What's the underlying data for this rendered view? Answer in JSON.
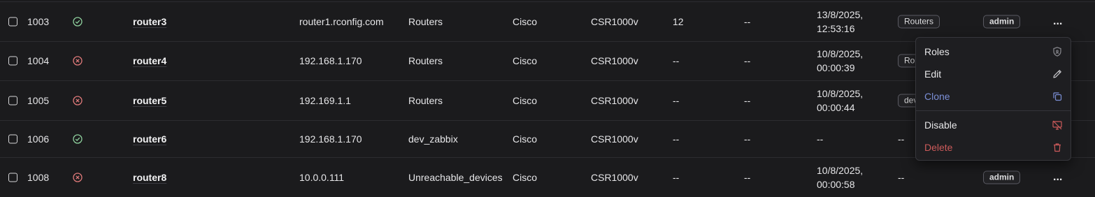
{
  "colors": {
    "background": "#1b1b1d",
    "status_ok": "#8fd19e",
    "status_error": "#e07a7a",
    "clone_text": "#7b8fd6",
    "delete_text": "#cc5a5a"
  },
  "rows": [
    {
      "id": "1003",
      "status": "check-circle-icon",
      "name": "router3",
      "address": "router1.rconfig.com",
      "category": "Routers",
      "vendor": "Cisco",
      "model": "CSR1000v",
      "col8": "12",
      "col9": "--",
      "date_line1": "13/8/2025,",
      "date_line2": "12:53:16",
      "tag": "Routers",
      "user": "admin",
      "more": "..."
    },
    {
      "id": "1004",
      "status": "x-circle-icon",
      "name": "router4",
      "address": "192.168.1.170",
      "category": "Routers",
      "vendor": "Cisco",
      "model": "CSR1000v",
      "col8": "--",
      "col9": "--",
      "date_line1": "10/8/2025,",
      "date_line2": "00:00:39",
      "tag": "Ro",
      "user": "",
      "more": ""
    },
    {
      "id": "1005",
      "status": "x-circle-icon",
      "name": "router5",
      "address": "192.169.1.1",
      "category": "Routers",
      "vendor": "Cisco",
      "model": "CSR1000v",
      "col8": "--",
      "col9": "--",
      "date_line1": "10/8/2025,",
      "date_line2": "00:00:44",
      "tag": "dev",
      "user": "",
      "more": ""
    },
    {
      "id": "1006",
      "status": "check-circle-icon",
      "name": "router6",
      "address": "192.168.1.170",
      "category": "dev_zabbix",
      "vendor": "Cisco",
      "model": "CSR1000v",
      "col8": "--",
      "col9": "--",
      "date_line1": "--",
      "date_line2": "",
      "tag": "--",
      "user": "",
      "more": ""
    },
    {
      "id": "1008",
      "status": "x-circle-icon",
      "name": "router8",
      "address": "10.0.0.111",
      "category": "Unreachable_devices",
      "vendor": "Cisco",
      "model": "CSR1000v",
      "col8": "--",
      "col9": "--",
      "date_line1": "10/8/2025,",
      "date_line2": "00:00:58",
      "tag": "--",
      "user": "admin",
      "more": "..."
    }
  ],
  "menu": {
    "items": [
      {
        "label": "Roles",
        "icon": "shield-icon"
      },
      {
        "label": "Edit",
        "icon": "pencil-icon"
      },
      {
        "label": "Clone",
        "icon": "copy-icon"
      },
      {
        "label": "Disable",
        "icon": "monitor-off-icon"
      },
      {
        "label": "Delete",
        "icon": "trash-icon"
      }
    ]
  }
}
